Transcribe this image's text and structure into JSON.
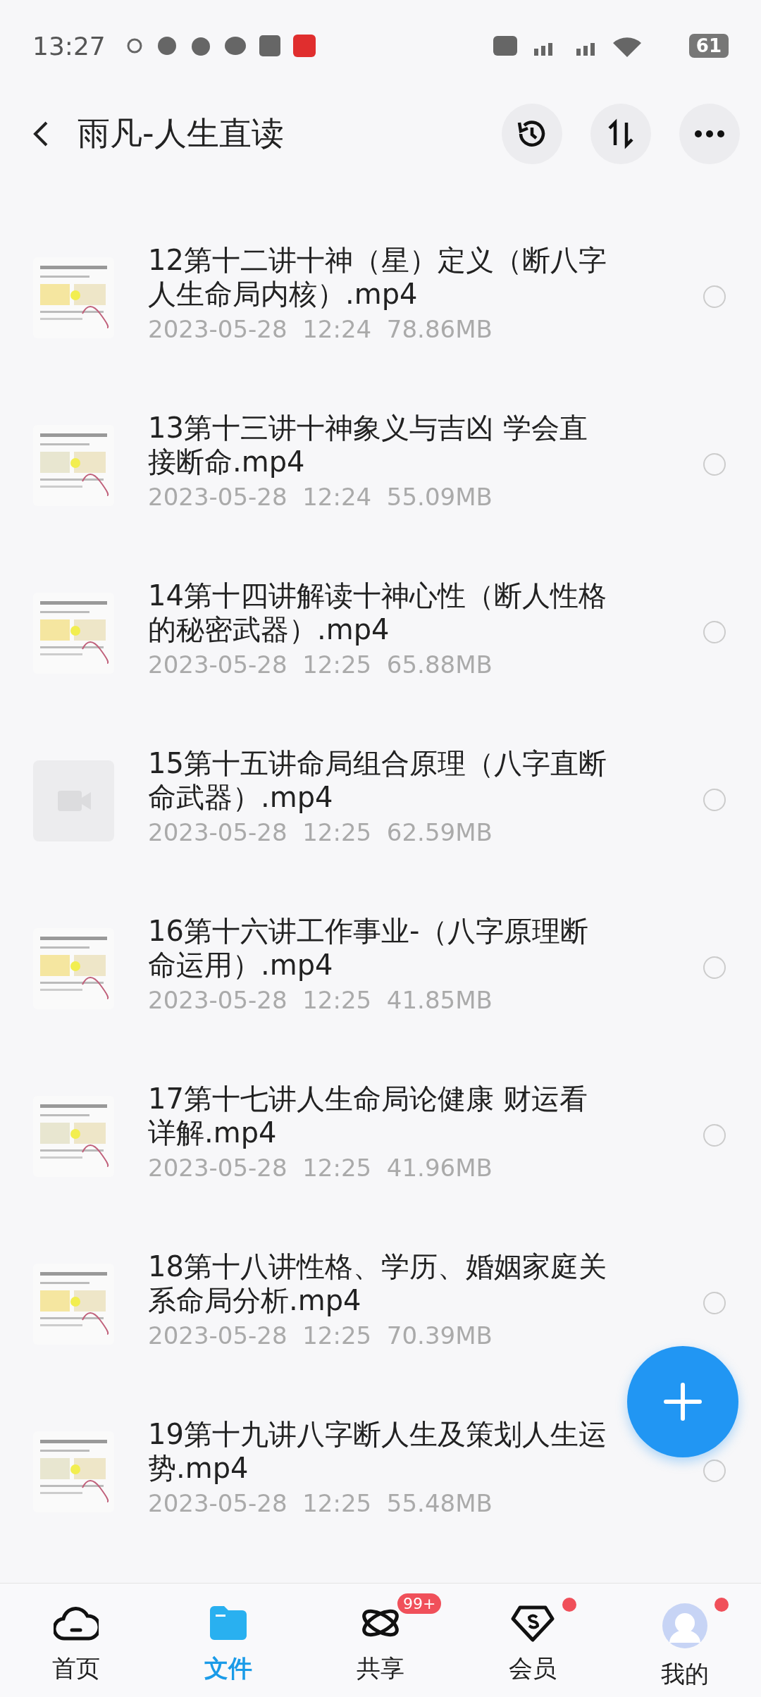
{
  "status_bar": {
    "time": "13:27",
    "battery": "61"
  },
  "header": {
    "title": "雨凡-人生直读"
  },
  "files": [
    {
      "name": "12第十二讲十神（星）定义（断八字人生命局内核）.mp4",
      "date": "2023-05-28",
      "time": "12:24",
      "size": "78.86MB",
      "kind": "picture",
      "selected": false
    },
    {
      "name": "13第十三讲十神象义与吉凶 学会直接断命.mp4",
      "date": "2023-05-28",
      "time": "12:24",
      "size": "55.09MB",
      "kind": "picture",
      "selected": false
    },
    {
      "name": "14第十四讲解读十神心性（断人性格的秘密武器）.mp4",
      "date": "2023-05-28",
      "time": "12:25",
      "size": "65.88MB",
      "kind": "picture",
      "selected": false
    },
    {
      "name": "15第十五讲命局组合原理（八字直断命武器）.mp4",
      "date": "2023-05-28",
      "time": "12:25",
      "size": "62.59MB",
      "kind": "video",
      "selected": false
    },
    {
      "name": "16第十六讲工作事业-（八字原理断命运用）.mp4",
      "date": "2023-05-28",
      "time": "12:25",
      "size": "41.85MB",
      "kind": "picture",
      "selected": false
    },
    {
      "name": "17第十七讲人生命局论健康 财运看详解.mp4",
      "date": "2023-05-28",
      "time": "12:25",
      "size": "41.96MB",
      "kind": "picture",
      "selected": false
    },
    {
      "name": "18第十八讲性格、学历、婚姻家庭关系命局分析.mp4",
      "date": "2023-05-28",
      "time": "12:25",
      "size": "70.39MB",
      "kind": "picture",
      "selected": false
    },
    {
      "name": "19第十九讲八字断人生及策划人生运势.mp4",
      "date": "2023-05-28",
      "time": "12:25",
      "size": "55.48MB",
      "kind": "picture",
      "selected": false
    }
  ],
  "nav": [
    {
      "label": "首页",
      "kind": "cloud",
      "selected": false
    },
    {
      "label": "文件",
      "kind": "folder",
      "selected": true
    },
    {
      "label": "共享",
      "kind": "share",
      "selected": false,
      "badge": "99+"
    },
    {
      "label": "会员",
      "kind": "vip",
      "selected": false,
      "dot": true
    },
    {
      "label": "我的",
      "kind": "avatar",
      "selected": false,
      "dot": true
    }
  ]
}
